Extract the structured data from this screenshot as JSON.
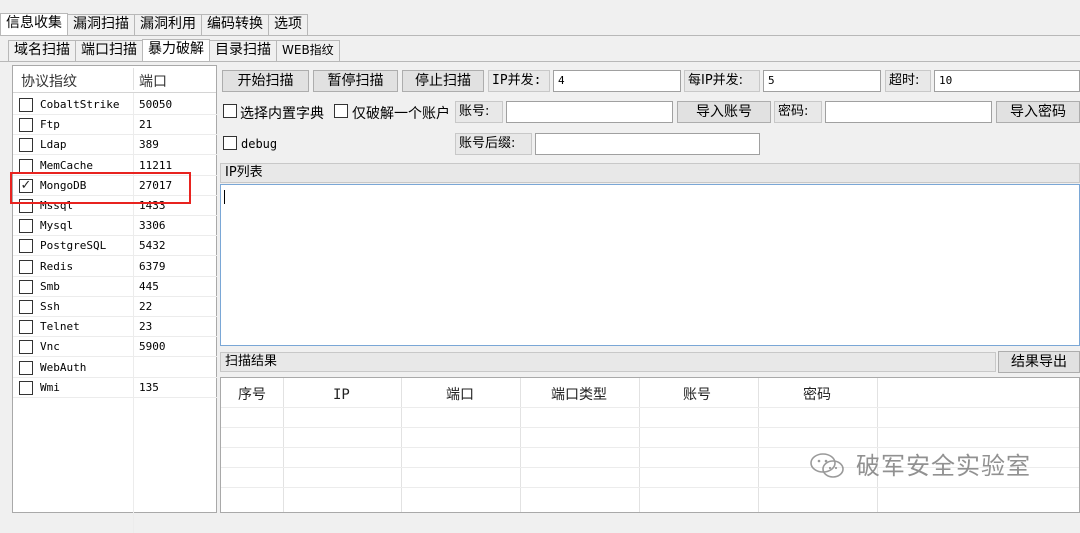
{
  "main_tabs": [
    "信息收集",
    "漏洞扫描",
    "漏洞利用",
    "编码转换",
    "选项"
  ],
  "sub_tabs": [
    "域名扫描",
    "端口扫描",
    "暴力破解",
    "目录扫描",
    "WEB指纹"
  ],
  "protocol_list": {
    "col_protocol": "协议指纹",
    "col_port": "端口",
    "items": [
      {
        "name": "CobaltStrike",
        "port": "50050",
        "checked": false
      },
      {
        "name": "Ftp",
        "port": "21",
        "checked": false
      },
      {
        "name": "Ldap",
        "port": "389",
        "checked": false
      },
      {
        "name": "MemCache",
        "port": "11211",
        "checked": false
      },
      {
        "name": "MongoDB",
        "port": "27017",
        "checked": true
      },
      {
        "name": "Mssql",
        "port": "1433",
        "checked": false
      },
      {
        "name": "Mysql",
        "port": "3306",
        "checked": false
      },
      {
        "name": "PostgreSQL",
        "port": "5432",
        "checked": false
      },
      {
        "name": "Redis",
        "port": "6379",
        "checked": false
      },
      {
        "name": "Smb",
        "port": "445",
        "checked": false
      },
      {
        "name": "Ssh",
        "port": "22",
        "checked": false
      },
      {
        "name": "Telnet",
        "port": "23",
        "checked": false
      },
      {
        "name": "Vnc",
        "port": "5900",
        "checked": false
      },
      {
        "name": "WebAuth",
        "port": "",
        "checked": false
      },
      {
        "name": "Wmi",
        "port": "135",
        "checked": false
      }
    ]
  },
  "toolbar": {
    "start_label": "开始扫描",
    "pause_label": "暂停扫描",
    "stop_label": "停止扫描",
    "ip_concurrency_label": "IP并发:",
    "ip_concurrency_value": "4",
    "per_ip_concurrency_label": "每IP并发:",
    "per_ip_concurrency_value": "5",
    "timeout_label": "超时:",
    "timeout_value": "10"
  },
  "options": {
    "builtin_dict_label": "选择内置字典",
    "single_account_label": "仅破解一个账户",
    "account_label": "账号:",
    "import_account_label": "导入账号",
    "password_label": "密码:",
    "import_password_label": "导入密码",
    "debug_label": "debug",
    "account_suffix_label": "账号后缀:"
  },
  "ip_list": {
    "title": "IP列表",
    "value": ""
  },
  "results": {
    "title": "扫描结果",
    "export_label": "结果导出",
    "columns": [
      "序号",
      "IP",
      "端口",
      "端口类型",
      "账号",
      "密码"
    ]
  },
  "watermark": "破军安全实验室",
  "colors": {
    "highlight": "#e8231f"
  }
}
